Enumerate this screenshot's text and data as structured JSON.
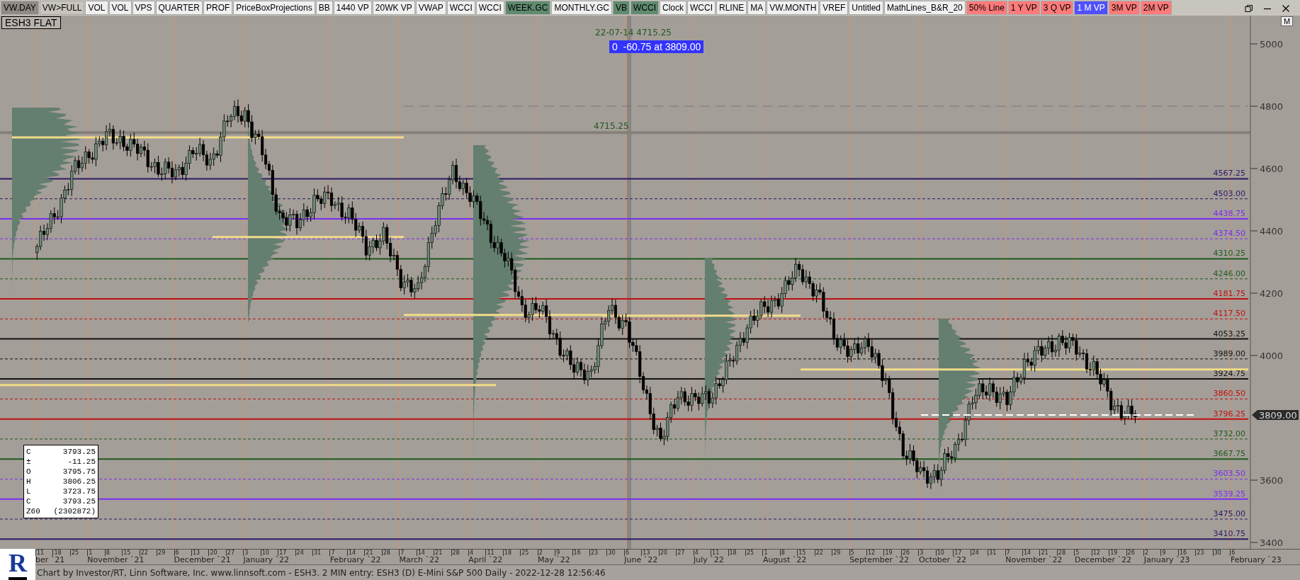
{
  "toolbar": {
    "buttons": [
      {
        "label": "VW.DAY",
        "color": "#8f8a86"
      },
      {
        "label": "VW>FULL",
        "color": "#c9c5bd"
      },
      {
        "label": "VOL",
        "color": "#f0f0f0"
      },
      {
        "label": "VOL",
        "color": "#f0f0f0"
      },
      {
        "label": "VPS",
        "color": "#f0f0f0"
      },
      {
        "label": "QUARTER",
        "color": "#f0f0f0"
      },
      {
        "label": "PROF",
        "color": "#f0f0f0"
      },
      {
        "label": "PriceBoxProjections",
        "color": "#f0f0f0"
      },
      {
        "label": "BB",
        "color": "#f0f0f0"
      },
      {
        "label": "1440 VP",
        "color": "#f0f0f0"
      },
      {
        "label": "20WK VP",
        "color": "#f0f0f0"
      },
      {
        "label": "VWAP",
        "color": "#f0f0f0"
      },
      {
        "label": "WCCI",
        "color": "#f0f0f0"
      },
      {
        "label": "WCCI",
        "color": "#f0f0f0"
      },
      {
        "label": "WEEK.GC",
        "color": "#5f8a6e"
      },
      {
        "label": "MONTHLY.GC",
        "color": "#f0f0f0"
      },
      {
        "label": "VB",
        "color": "#5f8a6e"
      },
      {
        "label": "WCCI",
        "color": "#5f8a6e"
      },
      {
        "label": "Clock",
        "color": "#f0f0f0"
      },
      {
        "label": "WCCI",
        "color": "#f0f0f0"
      },
      {
        "label": "RLINE",
        "color": "#f0f0f0"
      },
      {
        "label": "MA",
        "color": "#f0f0f0"
      },
      {
        "label": "VW.MONTH",
        "color": "#f0f0f0"
      },
      {
        "label": "VREF",
        "color": "#f0f0f0"
      },
      {
        "label": "Untitled",
        "color": "#f0f0f0"
      },
      {
        "label": "MathLines_B&R_20",
        "color": "#f0f0f0"
      },
      {
        "label": "50% Line",
        "color": "#ff7b7b"
      },
      {
        "label": "1 Y VP",
        "color": "#ff7b7b"
      },
      {
        "label": "3 Q VP",
        "color": "#ff7b7b"
      },
      {
        "label": "1 M VP",
        "color": "#5050ff"
      },
      {
        "label": "3M VP",
        "color": "#ff7b7b"
      },
      {
        "label": "2M VP",
        "color": "#ff7b7b"
      }
    ]
  },
  "chart": {
    "symbol": "ESH3 FLAT",
    "order_marker": "0  -60.75 at 3809.00",
    "swing_label": "22-07-14  4715.25",
    "high_label": "4715.25",
    "levels": [
      {
        "value": "4567.25",
        "color": "#2b1a66",
        "kind": "solid"
      },
      {
        "value": "4503.00",
        "color": "#2b1a66",
        "kind": "dashed"
      },
      {
        "value": "4438.75",
        "color": "#7a2cf0",
        "kind": "solid"
      },
      {
        "value": "4374.50",
        "color": "#7a2cf0",
        "kind": "dashed"
      },
      {
        "value": "4310.25",
        "color": "#1d5a1d",
        "kind": "solid"
      },
      {
        "value": "4246.00",
        "color": "#1d5a1d",
        "kind": "dashed"
      },
      {
        "value": "4181.75",
        "color": "#c01010",
        "kind": "solid"
      },
      {
        "value": "4117.50",
        "color": "#c01010",
        "kind": "dashed"
      },
      {
        "value": "4053.25",
        "color": "#111111",
        "kind": "solid"
      },
      {
        "value": "3989.00",
        "color": "#111111",
        "kind": "dashed"
      },
      {
        "value": "3924.75",
        "color": "#111111",
        "kind": "solid"
      },
      {
        "value": "3860.50",
        "color": "#c01010",
        "kind": "dashed"
      },
      {
        "value": "3796.25",
        "color": "#c01010",
        "kind": "solid"
      },
      {
        "value": "3732.00",
        "color": "#1d5a1d",
        "kind": "dashed"
      },
      {
        "value": "3667.75",
        "color": "#1d5a1d",
        "kind": "solid"
      },
      {
        "value": "3603.50",
        "color": "#7a2cf0",
        "kind": "dashed"
      },
      {
        "value": "3539.25",
        "color": "#7a2cf0",
        "kind": "solid"
      },
      {
        "value": "3475.00",
        "color": "#2b1a66",
        "kind": "dashed"
      },
      {
        "value": "3410.75",
        "color": "#2b1a66",
        "kind": "solid"
      }
    ],
    "price_axis": {
      "button": "M",
      "ticks": [
        "5000",
        "4800",
        "4600",
        "4400",
        "4200",
        "4000",
        "3600",
        "3400"
      ],
      "current": "3809.00"
    },
    "ohlc": [
      {
        "label": "C",
        "value": "3793.25"
      },
      {
        "label": "±",
        "value": "-11.25"
      },
      {
        "label": "O",
        "value": "3795.75"
      },
      {
        "label": "H",
        "value": "3806.25"
      },
      {
        "label": "L",
        "value": "3723.75"
      },
      {
        "label": "C",
        "value": "3793.25"
      },
      {
        "label": "Z60",
        "value": "(2302872)"
      }
    ]
  },
  "date_axis": {
    "weeks": [
      {
        "day": "11",
        "month": "ber `21"
      },
      {
        "day": "18"
      },
      {
        "day": "25"
      },
      {
        "day": "1",
        "month": "November `21"
      },
      {
        "day": "8"
      },
      {
        "day": "15"
      },
      {
        "day": "22"
      },
      {
        "day": "29"
      },
      {
        "day": "6",
        "month": "December `21"
      },
      {
        "day": "13"
      },
      {
        "day": "20"
      },
      {
        "day": "27"
      },
      {
        "day": "3",
        "month": "January `22"
      },
      {
        "day": "10"
      },
      {
        "day": "17"
      },
      {
        "day": "24"
      },
      {
        "day": "31"
      },
      {
        "day": "7",
        "month": "February `22"
      },
      {
        "day": "14"
      },
      {
        "day": "21"
      },
      {
        "day": "28"
      },
      {
        "day": "7",
        "month": "March `22"
      },
      {
        "day": "14"
      },
      {
        "day": "21"
      },
      {
        "day": "28"
      },
      {
        "day": "4",
        "month": "April `22"
      },
      {
        "day": "11"
      },
      {
        "day": "18"
      },
      {
        "day": "25"
      },
      {
        "day": "2",
        "month": "May `22"
      },
      {
        "day": "9"
      },
      {
        "day": "16"
      },
      {
        "day": "23"
      },
      {
        "day": "30"
      },
      {
        "day": "6",
        "month": "June `22"
      },
      {
        "day": "13"
      },
      {
        "day": "20"
      },
      {
        "day": "27"
      },
      {
        "day": "4",
        "month": "July `22"
      },
      {
        "day": "11"
      },
      {
        "day": "18"
      },
      {
        "day": "25"
      },
      {
        "day": "1",
        "month": "August `22"
      },
      {
        "day": "8"
      },
      {
        "day": "15"
      },
      {
        "day": "22"
      },
      {
        "day": "29"
      },
      {
        "day": "5",
        "month": "September `22"
      },
      {
        "day": "12"
      },
      {
        "day": "19"
      },
      {
        "day": "26"
      },
      {
        "day": "3",
        "month": "October `22"
      },
      {
        "day": "10"
      },
      {
        "day": "17"
      },
      {
        "day": "24"
      },
      {
        "day": "31"
      },
      {
        "day": "7",
        "month": "November `22"
      },
      {
        "day": "14"
      },
      {
        "day": "21"
      },
      {
        "day": "28"
      },
      {
        "day": "5",
        "month": "December `22"
      },
      {
        "day": "12"
      },
      {
        "day": "19"
      },
      {
        "day": "26"
      },
      {
        "day": "2",
        "month": "January `23"
      },
      {
        "day": "9"
      },
      {
        "day": "16"
      },
      {
        "day": "23"
      },
      {
        "day": "30"
      },
      {
        "day": "6",
        "month": "February `23"
      }
    ]
  },
  "status_bar": {
    "logo": "R",
    "text": "Chart by Investor/RT, Linn Software, Inc. www.linnsoft.com - ESH3. 2 MIN entry: ESH3 (D) E-Mini S&P 500 Daily - 2022-12-28 12:56:46"
  }
}
